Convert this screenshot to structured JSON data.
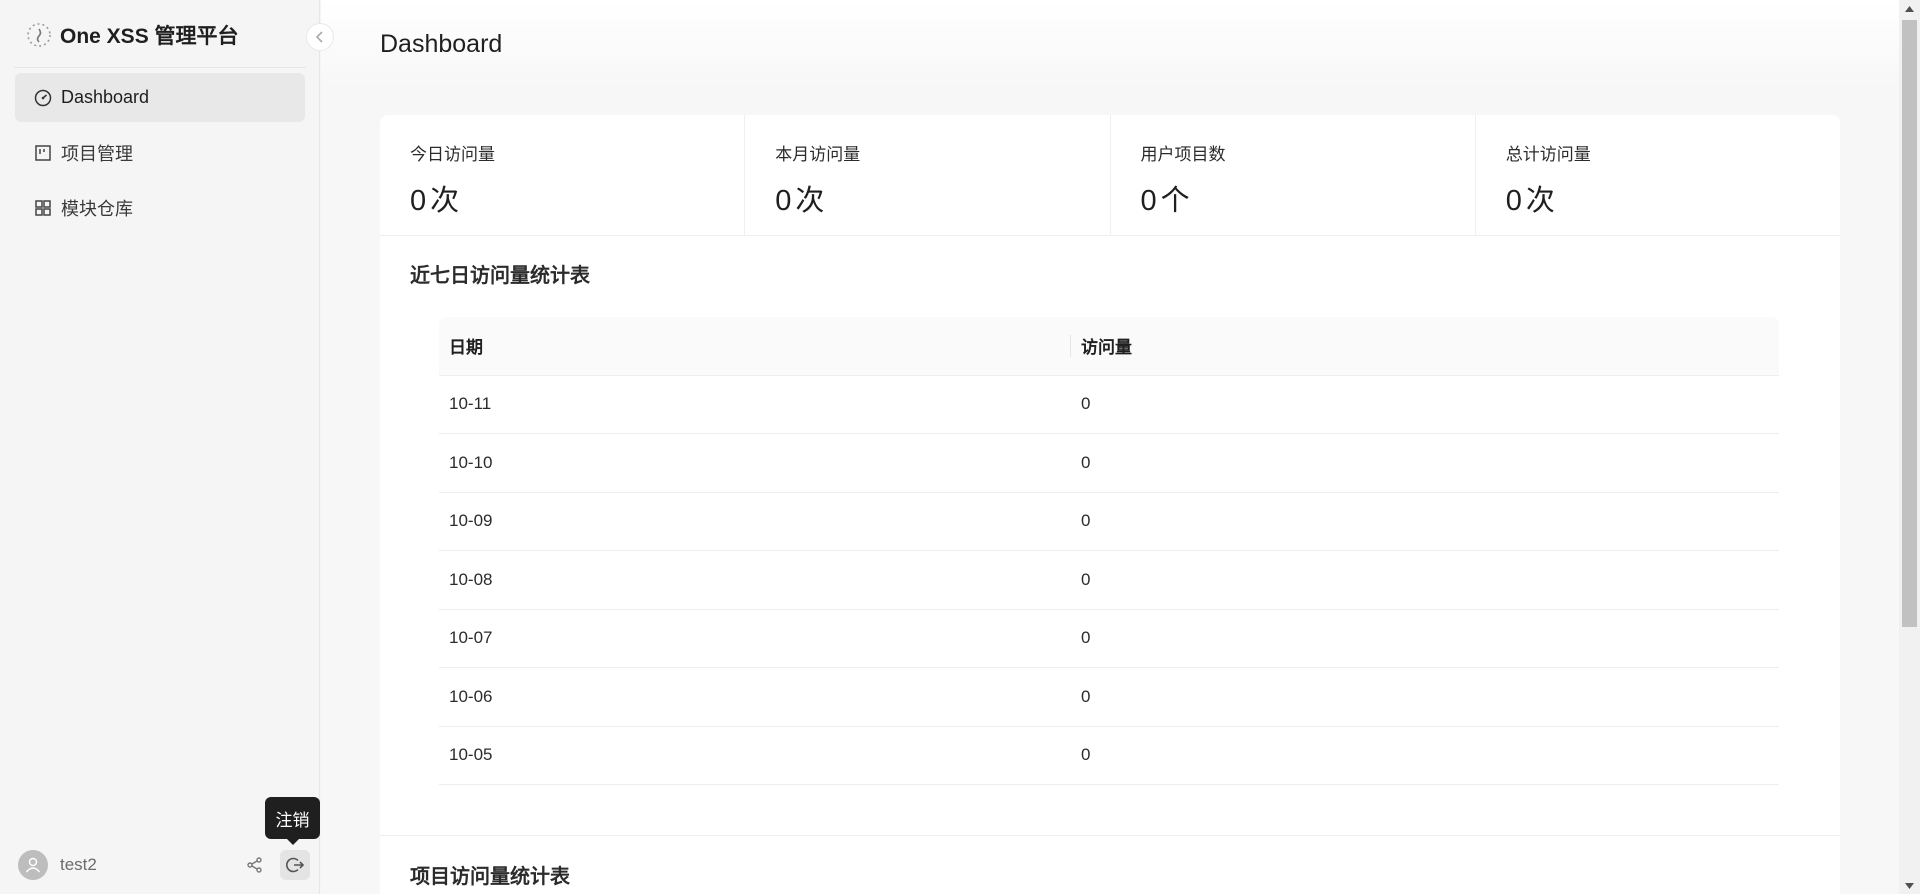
{
  "app": {
    "title": "One XSS 管理平台"
  },
  "sidebar": {
    "items": [
      {
        "label": "Dashboard",
        "icon": "dashboard-icon",
        "active": true
      },
      {
        "label": "项目管理",
        "icon": "project-icon",
        "active": false
      },
      {
        "label": "模块仓库",
        "icon": "module-icon",
        "active": false
      }
    ]
  },
  "user": {
    "name": "test2",
    "logout_tooltip": "注销"
  },
  "page": {
    "title": "Dashboard"
  },
  "stats": [
    {
      "label": "今日访问量",
      "value": "0",
      "unit": "次"
    },
    {
      "label": "本月访问量",
      "value": "0",
      "unit": "次"
    },
    {
      "label": "用户项目数",
      "value": "0",
      "unit": "个"
    },
    {
      "label": "总计访问量",
      "value": "0",
      "unit": "次"
    }
  ],
  "weekly_table": {
    "title": "近七日访问量统计表",
    "columns": [
      "日期",
      "访问量"
    ],
    "rows": [
      [
        "10-11",
        "0"
      ],
      [
        "10-10",
        "0"
      ],
      [
        "10-09",
        "0"
      ],
      [
        "10-08",
        "0"
      ],
      [
        "10-07",
        "0"
      ],
      [
        "10-06",
        "0"
      ],
      [
        "10-05",
        "0"
      ]
    ]
  },
  "project_section": {
    "title": "项目访问量统计表"
  },
  "colors": {
    "sidebar_bg": "#f5f5f5",
    "active_item_bg": "#e8e8e8",
    "tooltip_bg": "#1f1f1f"
  }
}
